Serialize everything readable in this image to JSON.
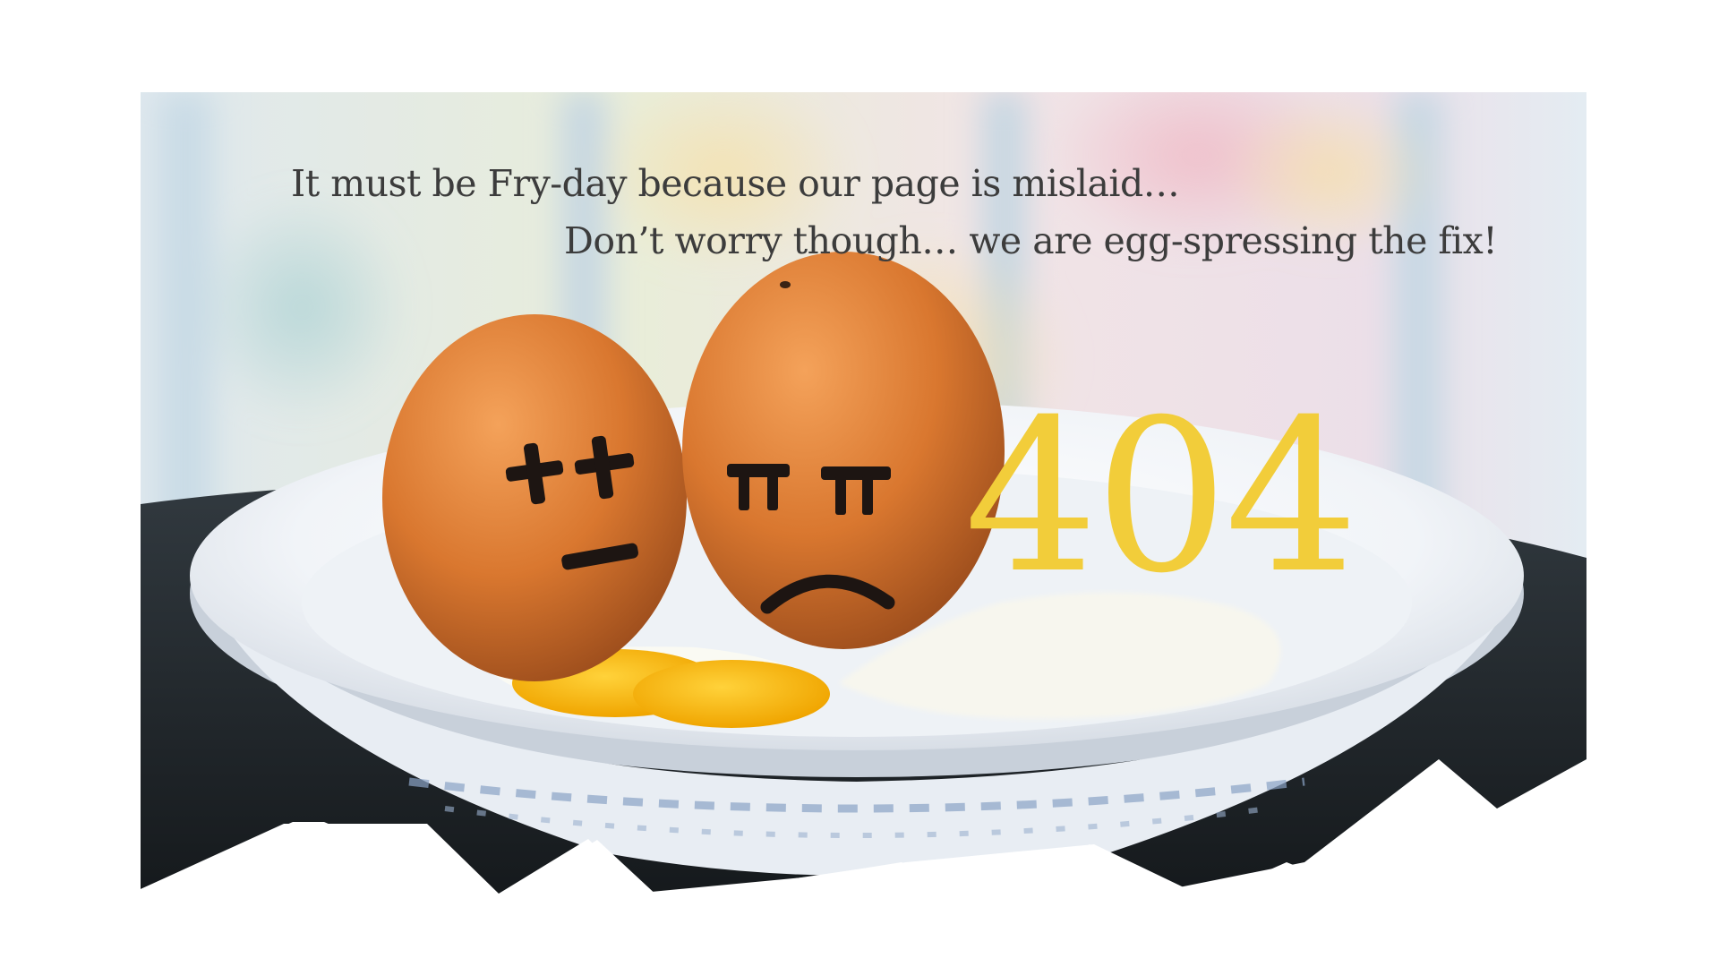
{
  "page": {
    "headline_line1": "It must be Fry-day because our page is mislaid…",
    "headline_line2": "Don’t worry though… we are egg-spressing the fix!",
    "error_code": "404"
  },
  "colors": {
    "background": "#ffffff",
    "headline_text": "#3c3c3c",
    "error_code": "#f2cd3a",
    "egg_shell": "#d9782e",
    "yolk": "#f7b90c",
    "plate": "#f4f6f9",
    "table": "#262b30"
  },
  "illustration": {
    "left_egg_face": "dizzy-cross-eyes-face",
    "right_egg_face": "sad-frown-face",
    "plate": "white-ceramic-bowl",
    "broken_eggs": [
      "fried-yolk",
      "egg-white"
    ]
  }
}
